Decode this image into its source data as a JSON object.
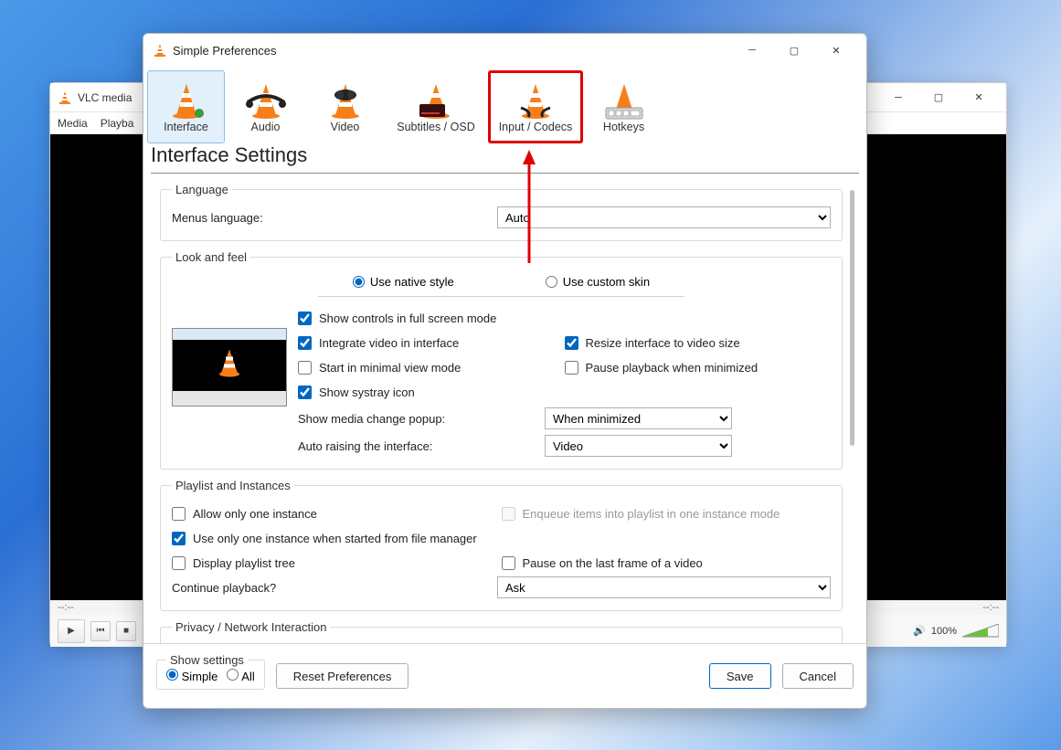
{
  "bg": {
    "title": "VLC media",
    "menus": [
      "Media",
      "Playba"
    ],
    "time_left": "--:--",
    "time_right": "--:--",
    "volume_pct": "100%"
  },
  "prefs": {
    "title": "Simple Preferences",
    "tabs": {
      "interface": "Interface",
      "audio": "Audio",
      "video": "Video",
      "subtitles": "Subtitles / OSD",
      "input_codecs": "Input / Codecs",
      "hotkeys": "Hotkeys"
    },
    "section_title": "Interface Settings",
    "language": {
      "legend": "Language",
      "menus_label": "Menus language:",
      "value": "Auto"
    },
    "look": {
      "legend": "Look and feel",
      "native": "Use native style",
      "custom": "Use custom skin",
      "cb1": "Show controls in full screen mode",
      "cb2": "Integrate video in interface",
      "cb3": "Start in minimal view mode",
      "cb4": "Show systray icon",
      "cb5": "Resize interface to video size",
      "cb6": "Pause playback when minimized",
      "popup_label": "Show media change popup:",
      "popup_value": "When minimized",
      "raise_label": "Auto raising the interface:",
      "raise_value": "Video"
    },
    "playlist": {
      "legend": "Playlist and Instances",
      "cb1": "Allow only one instance",
      "cb2": "Enqueue items into playlist in one instance mode",
      "cb3": "Use only one instance when started from file manager",
      "cb4": "Display playlist tree",
      "cb5": "Pause on the last frame of a video",
      "continue_label": "Continue playback?",
      "continue_value": "Ask"
    },
    "privacy_legend": "Privacy / Network Interaction",
    "footer": {
      "show_settings": "Show settings",
      "simple": "Simple",
      "all": "All",
      "reset": "Reset Preferences",
      "save": "Save",
      "cancel": "Cancel"
    }
  }
}
